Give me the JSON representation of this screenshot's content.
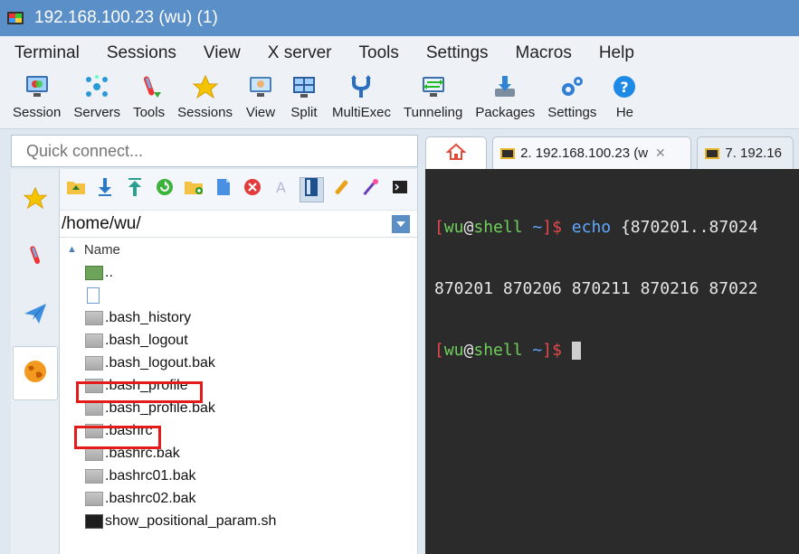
{
  "window": {
    "title": "192.168.100.23 (wu) (1)"
  },
  "menu": [
    "Terminal",
    "Sessions",
    "View",
    "X server",
    "Tools",
    "Settings",
    "Macros",
    "Help"
  ],
  "toolbar": [
    {
      "label": "Session",
      "icon": "session-monitor-icon"
    },
    {
      "label": "Servers",
      "icon": "servers-network-icon"
    },
    {
      "label": "Tools",
      "icon": "tools-icon"
    },
    {
      "label": "Sessions",
      "icon": "star-icon"
    },
    {
      "label": "View",
      "icon": "view-monitor-icon"
    },
    {
      "label": "Split",
      "icon": "split-icon"
    },
    {
      "label": "MultiExec",
      "icon": "multiexec-fork-icon"
    },
    {
      "label": "Tunneling",
      "icon": "tunneling-icon"
    },
    {
      "label": "Packages",
      "icon": "packages-download-icon"
    },
    {
      "label": "Settings",
      "icon": "gears-icon"
    },
    {
      "label": "He",
      "icon": "help-icon"
    }
  ],
  "quick_connect": {
    "placeholder": "Quick connect..."
  },
  "tabs": [
    {
      "label": "",
      "icon": "home-icon"
    },
    {
      "label": "2. 192.168.100.23 (w",
      "icon": "terminal-tab-icon"
    },
    {
      "label": "7. 192.16",
      "icon": "terminal-tab-icon"
    }
  ],
  "file_browser": {
    "path": "/home/wu/",
    "column": "Name",
    "files": [
      {
        "name": "..",
        "type": "up",
        "highlighted": false
      },
      {
        "name": "",
        "type": "blank",
        "highlighted": false
      },
      {
        "name": ".bash_history",
        "type": "file",
        "highlighted": false
      },
      {
        "name": ".bash_logout",
        "type": "file",
        "highlighted": false
      },
      {
        "name": ".bash_logout.bak",
        "type": "file",
        "highlighted": false
      },
      {
        "name": ".bash_profile",
        "type": "file",
        "highlighted": true
      },
      {
        "name": ".bash_profile.bak",
        "type": "file",
        "highlighted": false
      },
      {
        "name": ".bashrc",
        "type": "file",
        "highlighted": true
      },
      {
        "name": ".bashrc.bak",
        "type": "file",
        "highlighted": false
      },
      {
        "name": ".bashrc01.bak",
        "type": "file",
        "highlighted": false
      },
      {
        "name": ".bashrc02.bak",
        "type": "file",
        "highlighted": false
      },
      {
        "name": "show_positional_param.sh",
        "type": "script",
        "highlighted": false
      }
    ]
  },
  "terminal": {
    "prompt_open": "[",
    "prompt_user": "wu",
    "prompt_at": "@",
    "prompt_host": "shell",
    "prompt_dir": " ~",
    "prompt_close": "]$ ",
    "command_name": "echo",
    "command_args": " {870201..87024",
    "output": "870201 870206 870211 870216 87022"
  },
  "colors": {
    "accent": "#5a8fc8",
    "terminal_bg": "#2b2b2b",
    "highlight_box": "#e41b1b"
  }
}
